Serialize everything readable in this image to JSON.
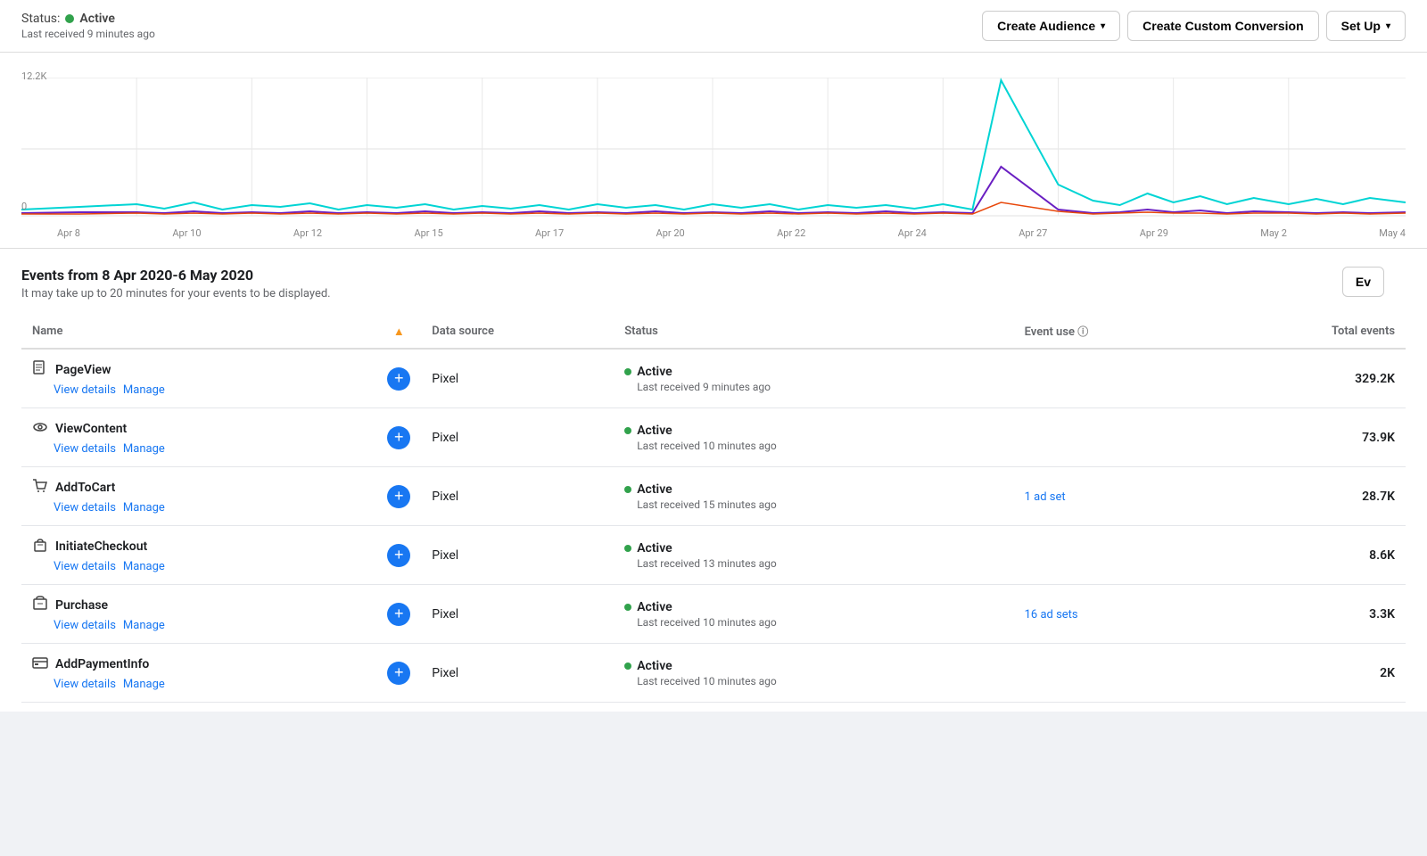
{
  "topBar": {
    "status_label": "Status:",
    "status_value": "Active",
    "last_received": "Last received 9 minutes ago",
    "buttons": {
      "create_audience": "Create Audience",
      "create_custom_conversion": "Create Custom Conversion",
      "set_up": "Set Up"
    }
  },
  "chart": {
    "y_top": "12.2K",
    "y_bottom": "0",
    "x_labels": [
      "Apr 8",
      "Apr 10",
      "Apr 12",
      "Apr 15",
      "Apr 17",
      "Apr 20",
      "Apr 22",
      "Apr 24",
      "Apr 27",
      "Apr 29",
      "May 2",
      "May 4"
    ]
  },
  "events": {
    "title": "Events from 8 Apr 2020-6 May 2020",
    "subtitle": "It may take up to 20 minutes for your events to be displayed.",
    "ev_button": "Ev",
    "columns": {
      "name": "Name",
      "warning": "⚠",
      "data_source": "Data source",
      "status": "Status",
      "event_use": "Event use",
      "total_events": "Total events"
    },
    "rows": [
      {
        "icon": "page",
        "name": "PageView",
        "has_warning": true,
        "data_source": "Pixel",
        "status": "Active",
        "last_received": "Last received 9 minutes ago",
        "event_use": "",
        "total_events": "329.2K",
        "view_details": "View details",
        "manage": "Manage"
      },
      {
        "icon": "eye",
        "name": "ViewContent",
        "has_warning": false,
        "data_source": "Pixel",
        "status": "Active",
        "last_received": "Last received 10 minutes ago",
        "event_use": "",
        "total_events": "73.9K",
        "view_details": "View details",
        "manage": "Manage"
      },
      {
        "icon": "cart",
        "name": "AddToCart",
        "has_warning": false,
        "data_source": "Pixel",
        "status": "Active",
        "last_received": "Last received 15 minutes ago",
        "event_use": "1 ad set",
        "total_events": "28.7K",
        "view_details": "View details",
        "manage": "Manage"
      },
      {
        "icon": "bag",
        "name": "InitiateCheckout",
        "has_warning": false,
        "data_source": "Pixel",
        "status": "Active",
        "last_received": "Last received 13 minutes ago",
        "event_use": "",
        "total_events": "8.6K",
        "view_details": "View details",
        "manage": "Manage"
      },
      {
        "icon": "purchase",
        "name": "Purchase",
        "has_warning": false,
        "data_source": "Pixel",
        "status": "Active",
        "last_received": "Last received 10 minutes ago",
        "event_use": "16 ad sets",
        "total_events": "3.3K",
        "view_details": "View details",
        "manage": "Manage"
      },
      {
        "icon": "card",
        "name": "AddPaymentInfo",
        "has_warning": false,
        "data_source": "Pixel",
        "status": "Active",
        "last_received": "Last received 10 minutes ago",
        "event_use": "",
        "total_events": "2K",
        "view_details": "View details",
        "manage": "Manage"
      }
    ]
  }
}
